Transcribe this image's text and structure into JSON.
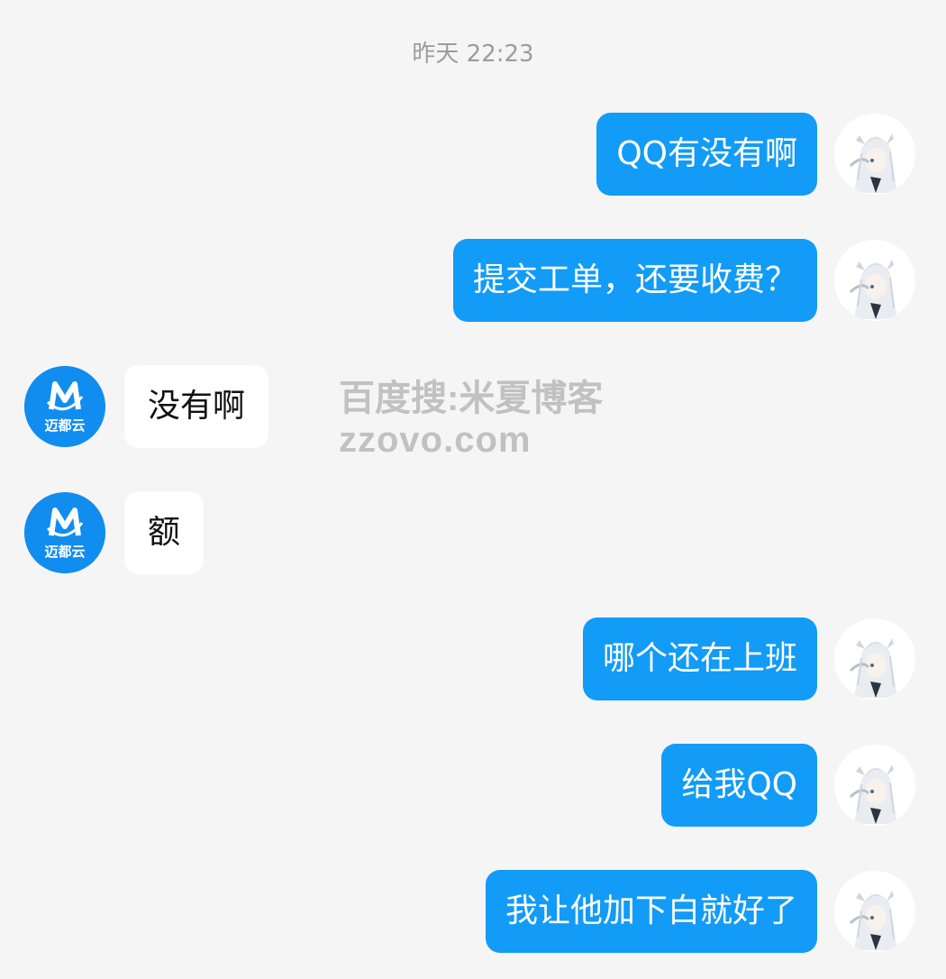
{
  "timestamp": "昨天 22:23",
  "watermark": {
    "line1": "百度搜:米夏博客",
    "line2": "zzovo.com"
  },
  "brand": {
    "logo_text": "迈都云",
    "accent_color": "#129bf7"
  },
  "messages": [
    {
      "side": "right",
      "text": "QQ有没有啊",
      "avatar": "anime-girl-avatar-icon"
    },
    {
      "side": "right",
      "text": "提交工单，还要收费？",
      "avatar": "anime-girl-avatar-icon"
    },
    {
      "side": "left",
      "text": "没有啊",
      "avatar": "maiduyun-logo-icon"
    },
    {
      "side": "left",
      "text": "额",
      "avatar": "maiduyun-logo-icon"
    },
    {
      "side": "right",
      "text": "哪个还在上班",
      "avatar": "anime-girl-avatar-icon"
    },
    {
      "side": "right",
      "text": "给我QQ",
      "avatar": "anime-girl-avatar-icon"
    },
    {
      "side": "right",
      "text": "我让他加下白就好了",
      "avatar": "anime-girl-avatar-icon"
    }
  ]
}
